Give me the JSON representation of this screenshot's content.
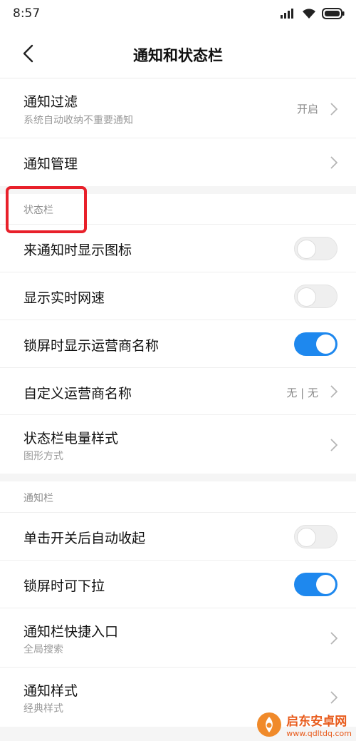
{
  "status_bar": {
    "time": "8:57"
  },
  "header": {
    "title": "通知和状态栏"
  },
  "rows": {
    "notification_filter": {
      "label": "通知过滤",
      "sub": "系统自动收纳不重要通知",
      "value": "开启"
    },
    "notification_manage": {
      "label": "通知管理"
    },
    "show_icon": {
      "label": "来通知时显示图标",
      "toggle": false
    },
    "show_speed": {
      "label": "显示实时网速",
      "toggle": false
    },
    "show_carrier": {
      "label": "锁屏时显示运营商名称",
      "toggle": true
    },
    "custom_carrier": {
      "label": "自定义运营商名称",
      "value": "无 | 无"
    },
    "battery_style": {
      "label": "状态栏电量样式",
      "sub": "图形方式"
    },
    "auto_collapse": {
      "label": "单击开关后自动收起",
      "toggle": false
    },
    "lock_pull": {
      "label": "锁屏时可下拉",
      "toggle": true
    },
    "quick_entry": {
      "label": "通知栏快捷入口",
      "sub": "全局搜索"
    },
    "notify_style": {
      "label": "通知样式",
      "sub": "经典样式"
    }
  },
  "sections": {
    "statusbar": "状态栏",
    "notificationbar": "通知栏"
  },
  "watermark": {
    "title": "启东安卓网",
    "url": "www.qdltdq.com"
  },
  "colors": {
    "accent": "#1e88ee",
    "highlight": "#e8202a"
  }
}
